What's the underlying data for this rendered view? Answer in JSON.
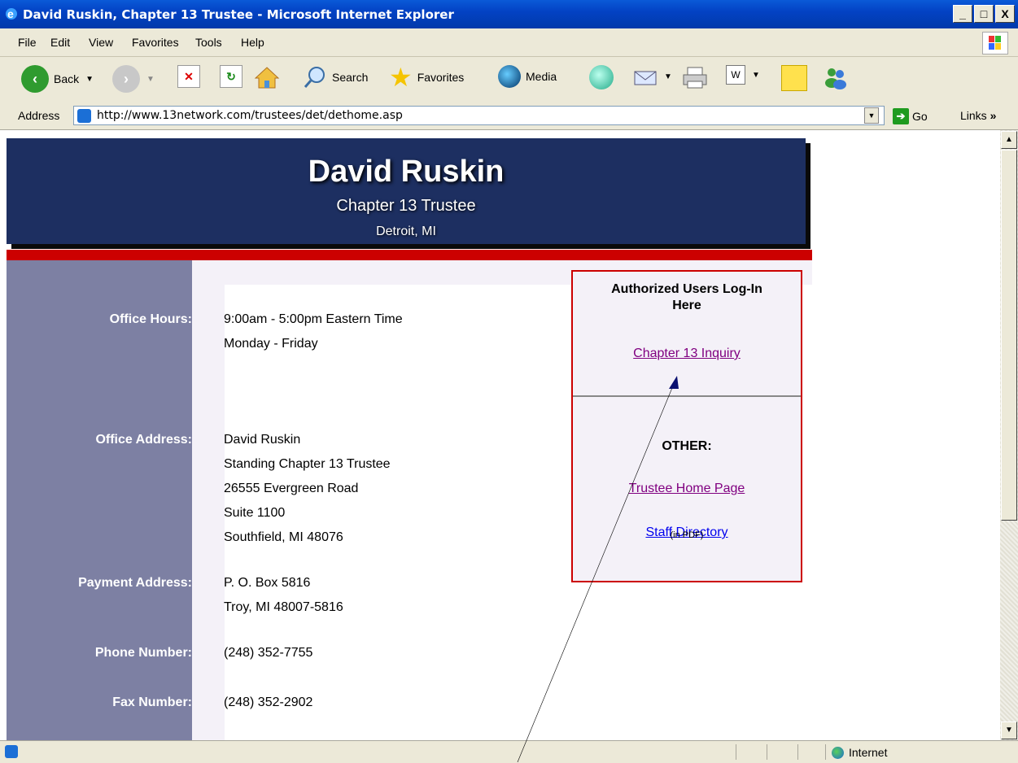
{
  "window": {
    "title": "David Ruskin, Chapter 13 Trustee - Microsoft Internet Explorer",
    "min": "_",
    "max": "□",
    "close": "X"
  },
  "menu": [
    "File",
    "Edit",
    "View",
    "Favorites",
    "Tools",
    "Help"
  ],
  "toolbar": {
    "back": "Back",
    "search": "Search",
    "favorites": "Favorites",
    "media": "Media"
  },
  "address": {
    "label": "Address",
    "url": "http://www.13network.com/trustees/det/dethome.asp",
    "go": "Go",
    "links": "Links"
  },
  "header": {
    "name": "David Ruskin",
    "subtitle": "Chapter 13 Trustee",
    "location": "Detroit, MI"
  },
  "info": [
    {
      "label": "Office Hours:",
      "lines": [
        "9:00am - 5:00pm Eastern Time",
        "Monday - Friday"
      ]
    },
    {
      "label": "Office Address:",
      "lines": [
        "David Ruskin",
        "Standing Chapter 13 Trustee",
        "26555 Evergreen Road",
        "Suite 1100",
        "Southfield, MI 48076"
      ]
    },
    {
      "label": "Payment Address:",
      "lines": [
        "P. O. Box 5816",
        "Troy, MI  48007-5816"
      ]
    },
    {
      "label": "Phone Number:",
      "lines": [
        "(248) 352-7755"
      ]
    },
    {
      "label": "Fax Number:",
      "lines": [
        "(248) 352-2902"
      ]
    }
  ],
  "login": {
    "title_line1": "Authorized Users Log-In",
    "title_line2": "Here",
    "inquiry_link": "Chapter 13 Inquiry",
    "other_title": "OTHER:",
    "home_link": "Trustee Home Page",
    "staff_link": "Staff Directory",
    "pdf_note": "(in PDF)"
  },
  "status": {
    "zone": "Internet"
  },
  "colors": {
    "header_bg": "#1d2f61",
    "accent_red": "#cc0000",
    "left_column": "#7d80a3",
    "visited_link": "#800080",
    "link": "#0000ee"
  }
}
